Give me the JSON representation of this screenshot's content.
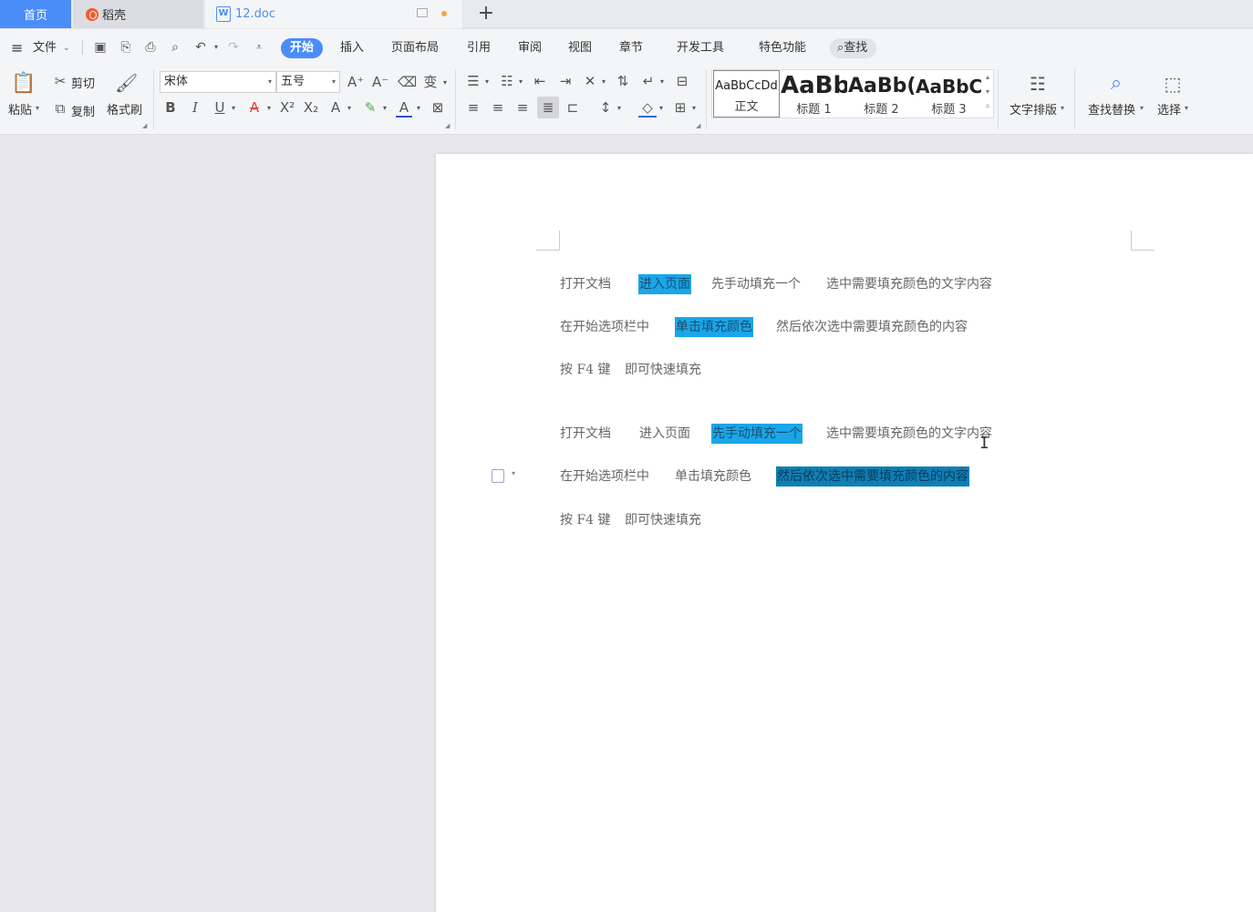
{
  "tabs": {
    "home": "首页",
    "daoke": "稻壳",
    "doc": "12.doc",
    "doc_icon": "W",
    "add": "+"
  },
  "menu": {
    "hamburger": "≡",
    "file": "文件",
    "items": [
      "开始",
      "插入",
      "页面布局",
      "引用",
      "审阅",
      "视图",
      "章节",
      "开发工具",
      "特色功能"
    ],
    "search": "查找"
  },
  "ribbon": {
    "paste": "粘贴",
    "cut": "剪切",
    "copy": "复制",
    "format_painter": "格式刷",
    "font_name": "宋体",
    "font_size": "五号",
    "bold": "B",
    "italic": "I",
    "underline": "U",
    "styles": [
      {
        "sample": "AaBbCcDd",
        "name": "正文"
      },
      {
        "sample": "AaBb",
        "name": "标题 1"
      },
      {
        "sample": "AaBb(",
        "name": "标题 2"
      },
      {
        "sample": "AaBbC",
        "name": "标题 3"
      }
    ],
    "text_layout": "文字排版",
    "find_replace": "查找替换",
    "select": "选择"
  },
  "document": {
    "lines": [
      {
        "segments": [
          {
            "text": "打开文档",
            "hl": ""
          },
          {
            "text": "进入页面",
            "hl": "light"
          },
          {
            "text": "先手动填充一个",
            "hl": ""
          },
          {
            "text": "选中需要填充颜色的文字内容",
            "hl": ""
          }
        ]
      },
      {
        "segments": [
          {
            "text": "在开始选项栏中",
            "hl": ""
          },
          {
            "text": "单击填充颜色",
            "hl": "light"
          },
          {
            "text": "然后依次选中需要填充颜色的内容",
            "hl": ""
          }
        ]
      },
      {
        "segments": [
          {
            "text": "按 F4 键",
            "hl": ""
          },
          {
            "text": "即可快速填充",
            "hl": ""
          }
        ]
      },
      {
        "segments": [
          {
            "text": "打开文档",
            "hl": ""
          },
          {
            "text": "进入页面",
            "hl": ""
          },
          {
            "text": "先手动填充一个",
            "hl": "light"
          },
          {
            "text": "选中需要填充颜色的文字内容",
            "hl": ""
          }
        ]
      },
      {
        "segments": [
          {
            "text": "在开始选项栏中",
            "hl": ""
          },
          {
            "text": "单击填充颜色",
            "hl": ""
          },
          {
            "text": "然后依次选中需要填充颜色的内容",
            "hl": "dark"
          }
        ]
      },
      {
        "segments": [
          {
            "text": "按 F4 键",
            "hl": ""
          },
          {
            "text": "即可快速填充",
            "hl": ""
          }
        ]
      }
    ]
  },
  "colors": {
    "accent": "#4b8df8",
    "highlight_light": "#1aa6e8",
    "highlight_dark": "#0e7fb5"
  }
}
